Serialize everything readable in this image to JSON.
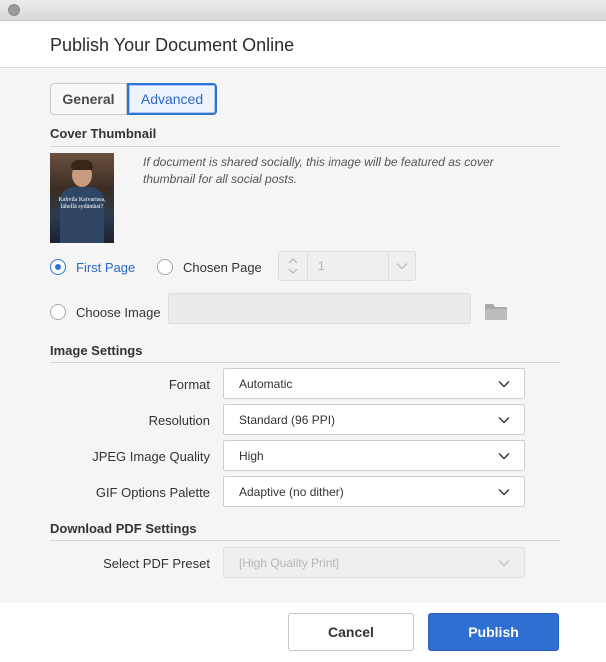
{
  "window": {
    "title": "Publish Your Document Online"
  },
  "tabs": [
    {
      "label": "General",
      "selected": false
    },
    {
      "label": "Advanced",
      "selected": true
    }
  ],
  "cover_thumbnail": {
    "heading": "Cover Thumbnail",
    "image_caption": "Kahvila Kaivarissa, lähellä sydäntäsi?",
    "description": "If document is shared socially, this image will be featured as cover thumbnail for all social posts.",
    "options": {
      "first_page": {
        "label": "First Page",
        "selected": true
      },
      "chosen_page": {
        "label": "Chosen Page",
        "selected": false,
        "page_value": "1"
      },
      "choose_image": {
        "label": "Choose Image",
        "selected": false,
        "path_value": ""
      }
    }
  },
  "image_settings": {
    "heading": "Image Settings",
    "format": {
      "label": "Format",
      "value": "Automatic"
    },
    "resolution": {
      "label": "Resolution",
      "value": "Standard (96 PPI)"
    },
    "jpeg_quality": {
      "label": "JPEG Image Quality",
      "value": "High"
    },
    "gif_palette": {
      "label": "GIF Options Palette",
      "value": "Adaptive (no dither)"
    }
  },
  "pdf_settings": {
    "heading": "Download PDF Settings",
    "preset": {
      "label": "Select PDF Preset",
      "value": "[High Quality Print]",
      "disabled": true
    }
  },
  "footer": {
    "cancel_label": "Cancel",
    "publish_label": "Publish"
  },
  "colors": {
    "accent": "#2f6fd2",
    "panel_bg": "#f5f5f5"
  },
  "icons": {
    "folder": "folder-icon",
    "dropdown": "chevron-down-icon",
    "stepper": "stepper-arrows-icon"
  }
}
